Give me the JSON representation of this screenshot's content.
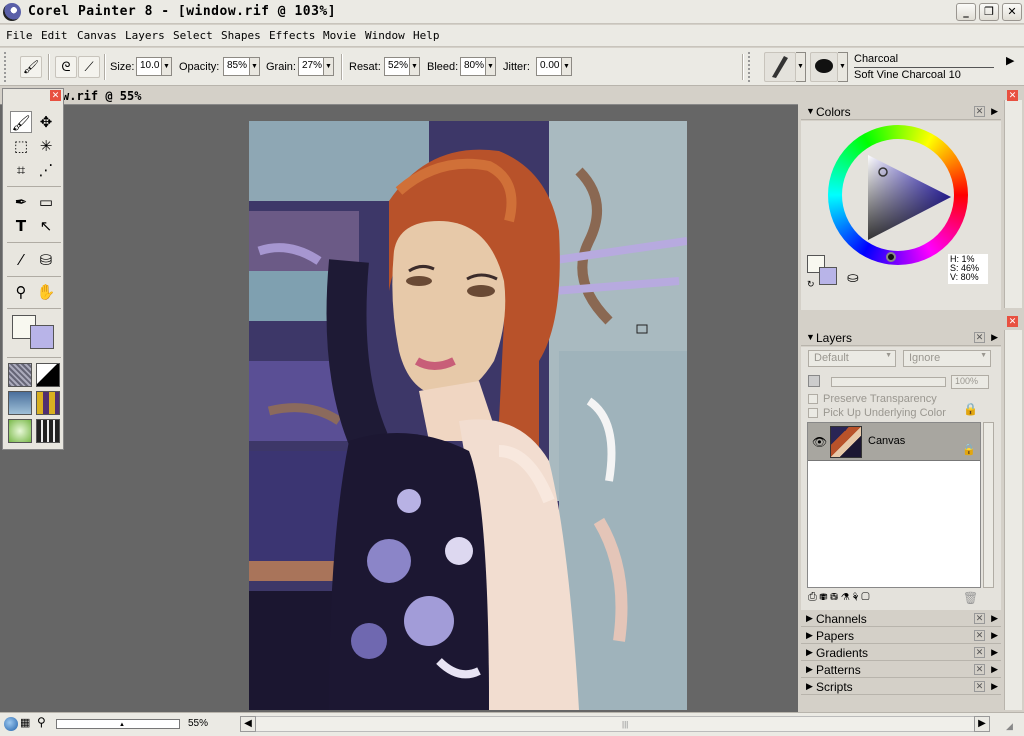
{
  "window": {
    "title": "Corel Painter 8 - [window.rif @ 103%]"
  },
  "menu": [
    "File",
    "Edit",
    "Canvas",
    "Layers",
    "Select",
    "Shapes",
    "Effects",
    "Movie",
    "Window",
    "Help"
  ],
  "property_bar": {
    "size_label": "Size:",
    "size_value": "10.0",
    "opacity_label": "Opacity:",
    "opacity_value": "85%",
    "grain_label": "Grain:",
    "grain_value": "27%",
    "resat_label": "Resat:",
    "resat_value": "52%",
    "bleed_label": "Bleed:",
    "bleed_value": "80%",
    "jitter_label": "Jitter:",
    "jitter_value": "0.00",
    "brush_category": "Charcoal",
    "brush_variant": "Soft Vine Charcoal 10"
  },
  "document": {
    "tab_title": "w.rif @ 55%"
  },
  "colors_panel": {
    "title": "Colors",
    "h": "H: 1%",
    "s": "S: 46%",
    "v": "V: 80%",
    "main_color": "#f8f8f0",
    "additional_color": "#b8b4e8"
  },
  "layers_panel": {
    "title": "Layers",
    "composite_method": "Default",
    "depth": "Ignore",
    "opacity": "100%",
    "preserve_transparency": "Preserve Transparency",
    "pick_up_underlying": "Pick Up Underlying Color",
    "layer_name": "Canvas"
  },
  "collapsed_panels": [
    "Channels",
    "Papers",
    "Gradients",
    "Patterns",
    "Scripts"
  ],
  "status": {
    "zoom": "55%"
  }
}
